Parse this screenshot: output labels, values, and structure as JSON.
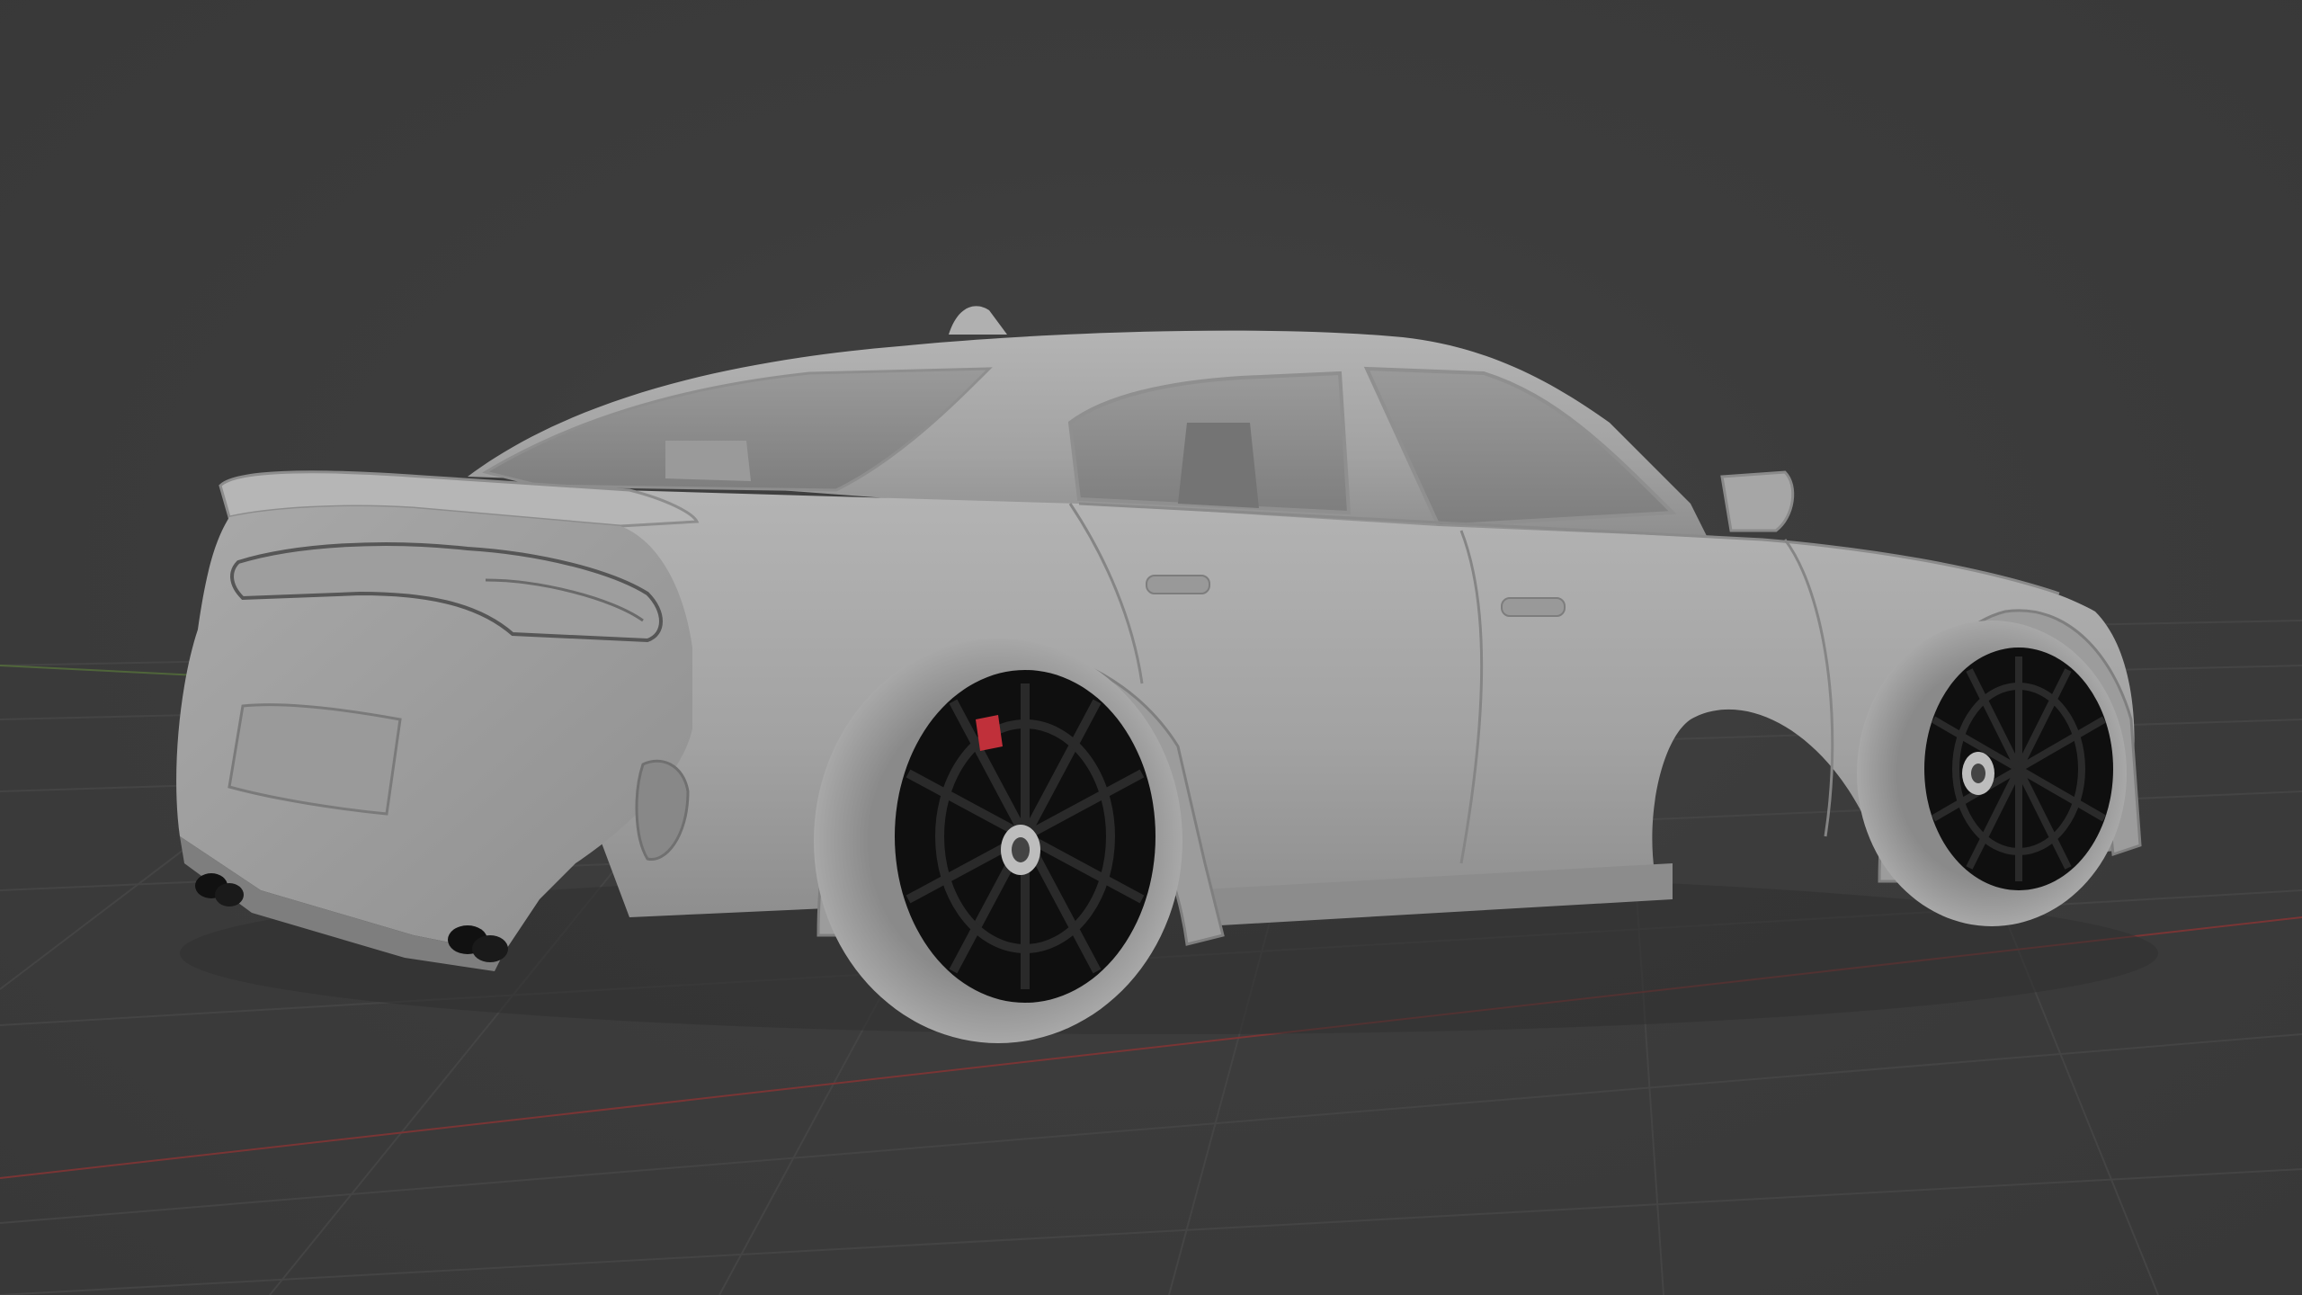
{
  "viewport": {
    "background_color": "#3d3d3d",
    "grid_color": "#4a4a4a",
    "x_axis_color": "#8a3a3a",
    "y_axis_color": "#5a7a3a"
  },
  "model": {
    "name": "car-model",
    "body_color": "#a8a8a8",
    "wheel_color": "#0e0e0e",
    "tire_color": "#9c9c9c",
    "glass_color": "#8a8a8a",
    "caliper_color": "#c0303a"
  }
}
